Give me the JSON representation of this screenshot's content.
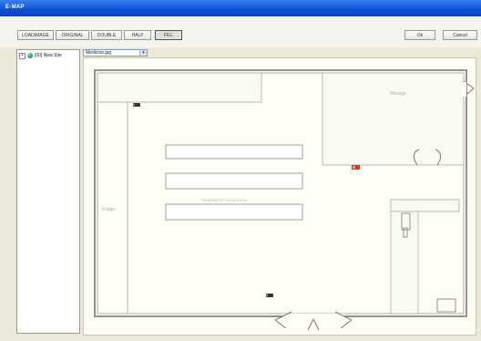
{
  "window": {
    "title": "E-MAP"
  },
  "toolbar": {
    "buttons": [
      "LOADIMAGE",
      "ORIGINAL",
      "DOUBLE",
      "HALF",
      "FILL"
    ],
    "active": "FILL",
    "ok_label": "Ok",
    "cancel_label": "Cancel"
  },
  "tree": {
    "expand_glyph": "+",
    "root_label": "[00] New Site"
  },
  "image_select": {
    "value": "Medicine.jpg",
    "arrow": "▾"
  },
  "map": {
    "labels": {
      "storage": "Storage",
      "fridge": "Fridge",
      "shelves": "Detected & Found Areas"
    }
  },
  "colors": {
    "titlebar": "#0a4fd6",
    "wall": "#6f6f6f",
    "camera_red": "#cc3b1d"
  }
}
